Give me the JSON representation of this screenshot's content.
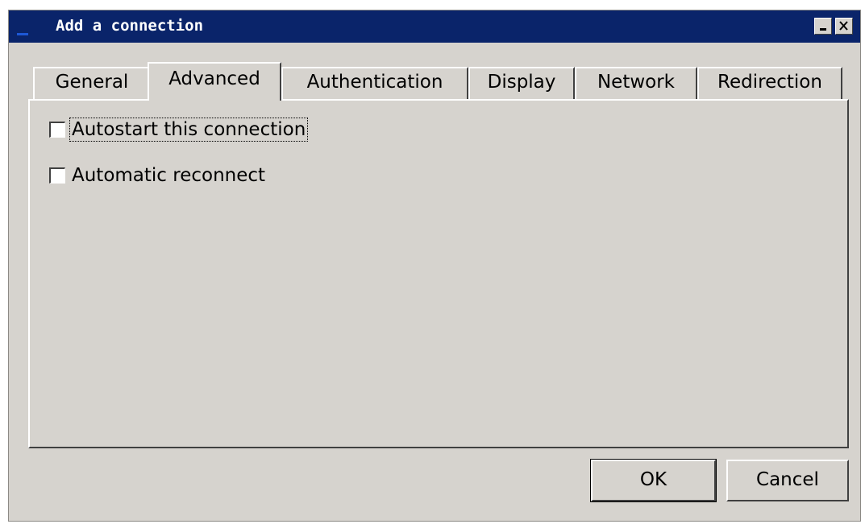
{
  "window": {
    "title": "Add a connection",
    "minimize_label": "_",
    "close_label": "X"
  },
  "tabs": [
    {
      "label": "General",
      "active": false
    },
    {
      "label": "Advanced",
      "active": true
    },
    {
      "label": "Authentication",
      "active": false
    },
    {
      "label": "Display",
      "active": false
    },
    {
      "label": "Network",
      "active": false
    },
    {
      "label": "Redirection",
      "active": false
    }
  ],
  "advanced": {
    "autostart": {
      "label": "Autostart this connection",
      "checked": false,
      "focused": true
    },
    "reconnect": {
      "label": "Automatic reconnect",
      "checked": false
    }
  },
  "buttons": {
    "ok": "OK",
    "cancel": "Cancel"
  },
  "colors": {
    "titlebar": "#0a246a",
    "face": "#d6d3ce"
  }
}
